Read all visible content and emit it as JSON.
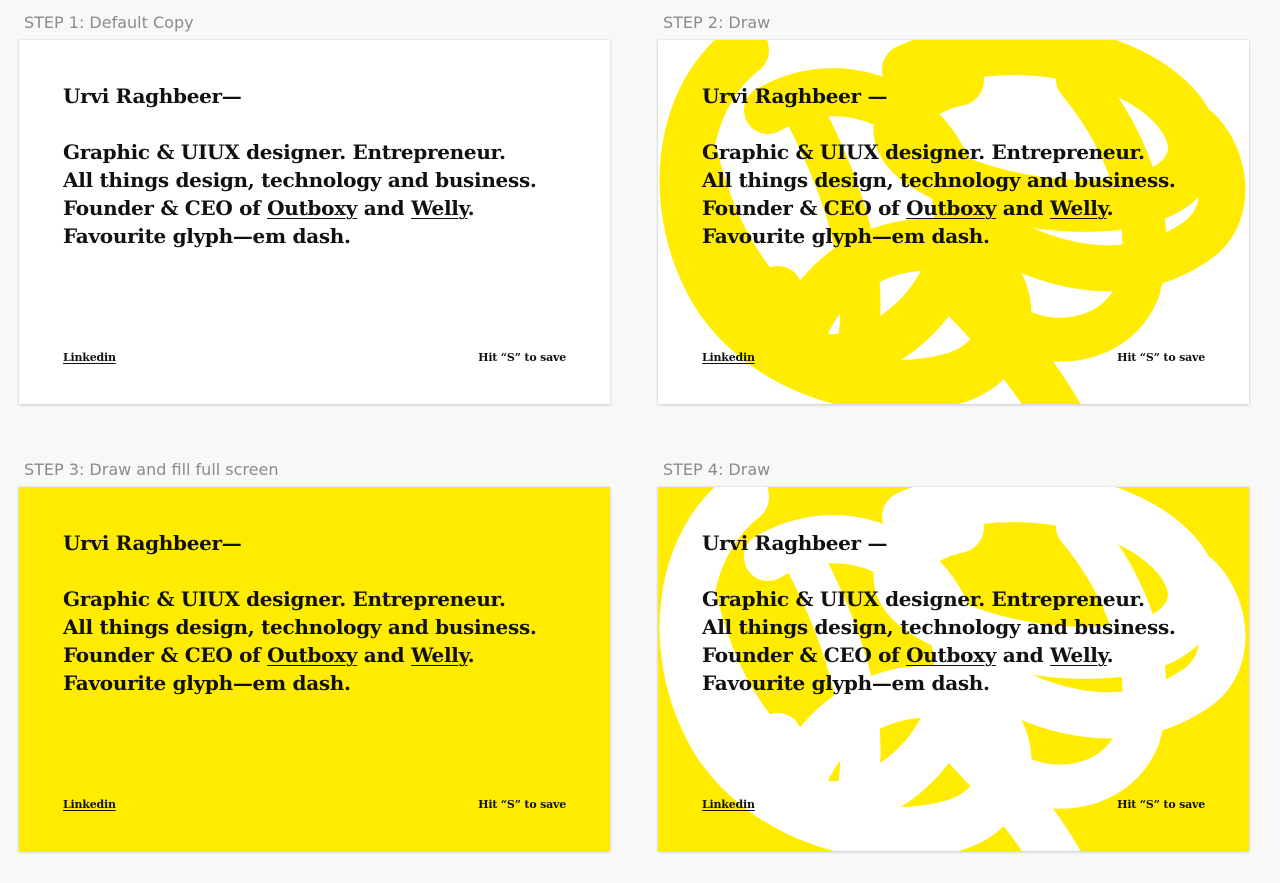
{
  "colors": {
    "page_background": "#f8f8f8",
    "card_white": "#ffffff",
    "highlight_yellow": "#ffec00",
    "text": "#111111",
    "label_gray": "#8b8b8b"
  },
  "card_copy": {
    "name_a": "Urvi Raghbeer—",
    "name_b": "Urvi Raghbeer —",
    "line1": "Graphic & UIUX designer. Entrepreneur.",
    "line2": "All things design, technology and business.",
    "line3_prefix": "Founder & CEO of ",
    "line3_link1": "Outboxy",
    "line3_middle": " and ",
    "line3_link2": "Welly",
    "line3_suffix": ".",
    "line4": "Favourite glyph—em dash.",
    "footer_link": "Linkedin",
    "footer_hint": "Hit “S” to save"
  },
  "steps": [
    {
      "label": "STEP 1: Default Copy",
      "background": "#ffffff",
      "scribble": "none"
    },
    {
      "label": "STEP 2: Draw",
      "background": "#ffffff",
      "scribble": "yellow"
    },
    {
      "label": "STEP 3: Draw and fill full screen",
      "background": "#ffec00",
      "scribble": "none"
    },
    {
      "label": "STEP 4: Draw",
      "background": "#ffec00",
      "scribble": "white"
    }
  ]
}
